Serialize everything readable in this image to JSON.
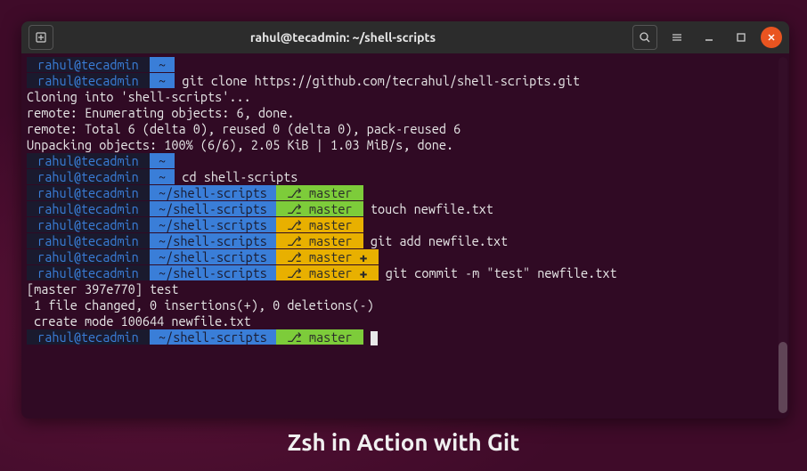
{
  "caption": "Zsh in Action with Git",
  "window": {
    "title": "rahul@tecadmin: ~/shell-scripts"
  },
  "prompt": {
    "user_host": " rahul@tecadmin ",
    "home_tilde": " ~ ",
    "shell_path": " ~/shell-scripts ",
    "branch_clean": " ⎇ master ",
    "branch_dirty": " ⎇ master ✚ "
  },
  "cmds": {
    "clone": " git clone https://github.com/tecrahul/shell-scripts.git",
    "cd": " cd shell-scripts",
    "touch": " touch newfile.txt",
    "add": " git add newfile.txt",
    "commit": " git commit -m \"test\" newfile.txt"
  },
  "output": {
    "clone1": "Cloning into 'shell-scripts'...",
    "clone2": "remote: Enumerating objects: 6, done.",
    "clone3": "remote: Total 6 (delta 0), reused 0 (delta 0), pack-reused 6",
    "clone4": "Unpacking objects: 100% (6/6), 2.05 KiB | 1.03 MiB/s, done.",
    "commit1": "[master 397e770] test",
    "commit2": " 1 file changed, 0 insertions(+), 0 deletions(-)",
    "commit3": " create mode 100644 newfile.txt"
  },
  "colors": {
    "ubuntu_orange": "#e95420",
    "term_bg": "#300a24",
    "titlebar_bg": "#2c2c2c",
    "blue": "#3a7ed8",
    "green": "#7dcc3a",
    "yellow": "#e8b000"
  }
}
